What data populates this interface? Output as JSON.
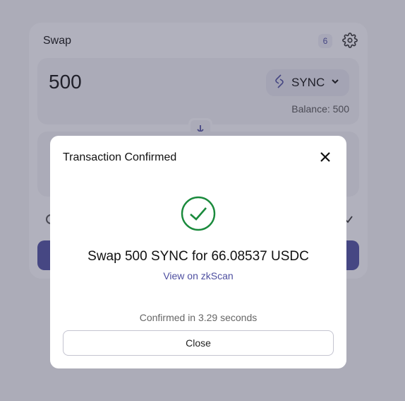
{
  "swap": {
    "title": "Swap",
    "notification_count": "6",
    "input_amount": "500",
    "input_token": "SYNC",
    "balance": "Balance: 500"
  },
  "modal": {
    "title": "Transaction Confirmed",
    "summary": "Swap 500 SYNC for 66.08537 USDC",
    "link_text": "View on zkScan",
    "confirmed_text": "Confirmed in 3.29 seconds",
    "close_label": "Close"
  },
  "colors": {
    "accent": "#4e4fa0",
    "success": "#1a8a3c"
  },
  "icons": [
    "gear-icon",
    "sync-token-icon",
    "chevron-down-icon",
    "arrow-down-icon",
    "close-icon",
    "success-check-icon",
    "check-icon"
  ]
}
